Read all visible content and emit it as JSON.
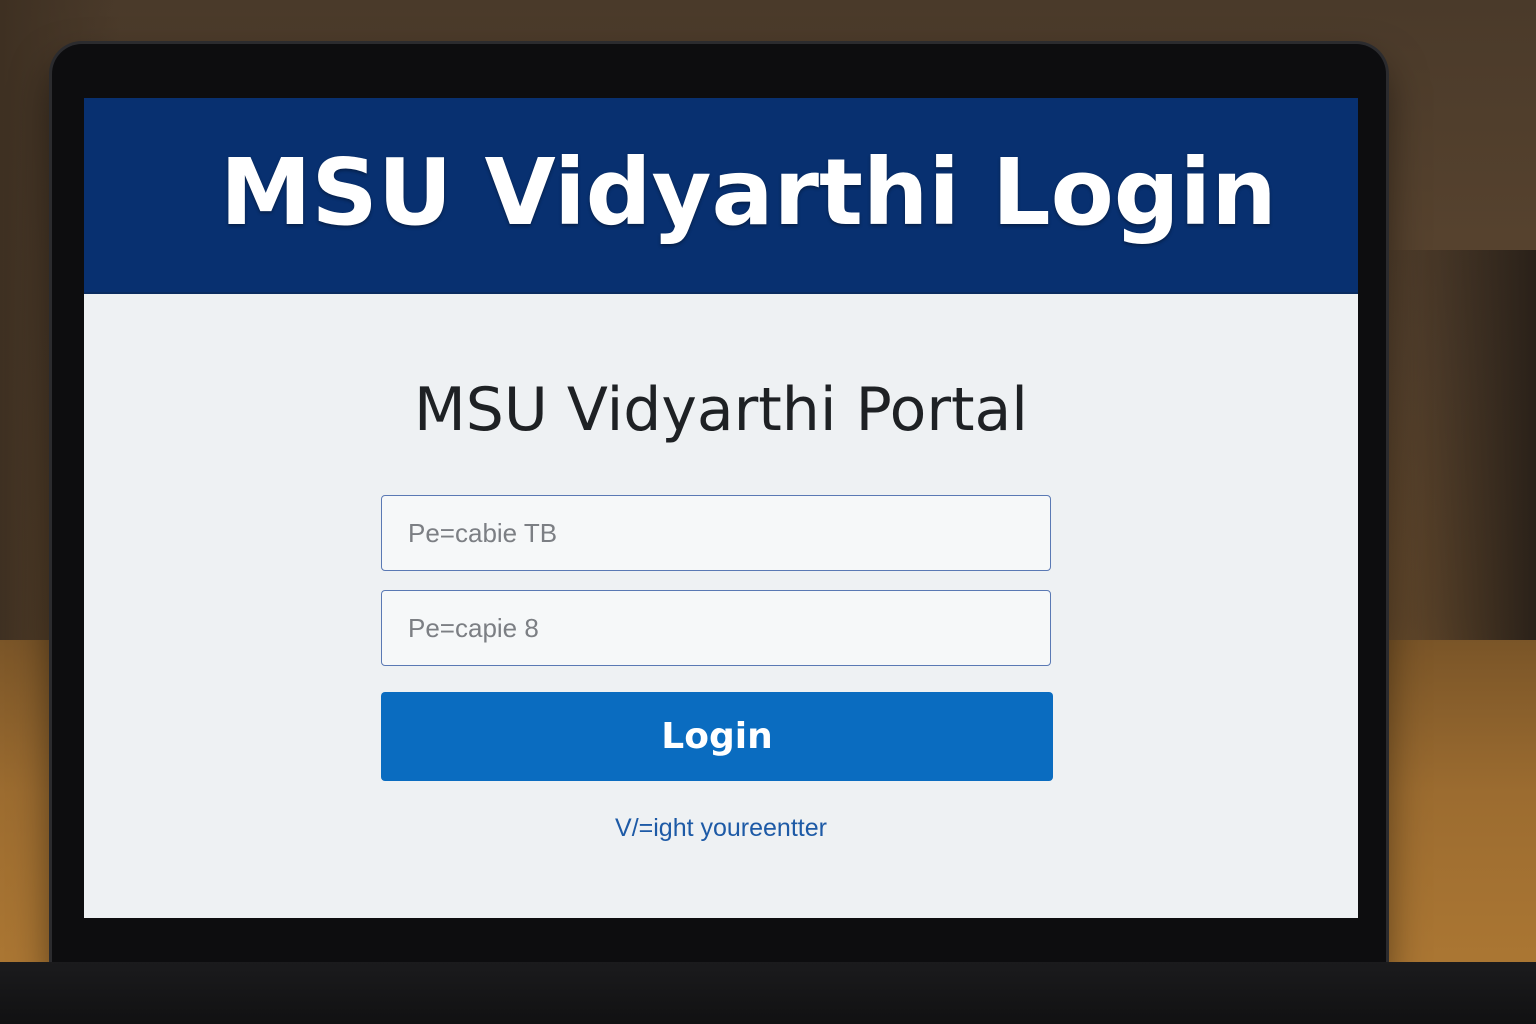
{
  "header": {
    "title": "MSU Vidyarthi Login"
  },
  "main": {
    "portal_title": "MSU Vidyarthi Portal",
    "field_1_placeholder": "Pe=cabie TB",
    "field_2_placeholder": "Pe=capie 8",
    "login_label": "Login",
    "help_link": "V/=ight youreentter"
  },
  "colors": {
    "banner": "#083070",
    "button": "#0a6cc0",
    "link": "#1d5aa6"
  }
}
